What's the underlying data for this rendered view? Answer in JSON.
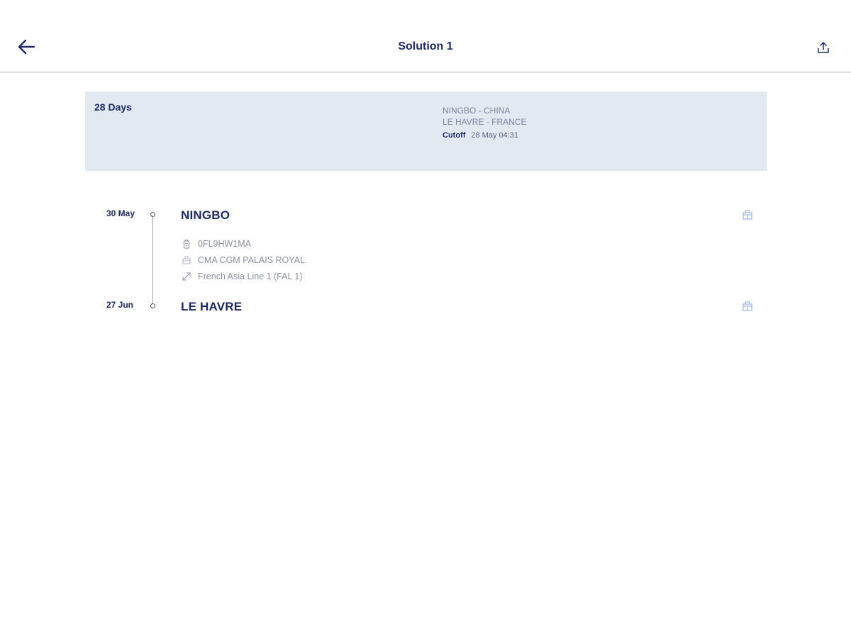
{
  "header": {
    "title": "Solution 1",
    "back_icon": "arrow-left-icon",
    "share_icon": "share-upload-icon"
  },
  "summary": {
    "duration": "28 Days",
    "origin": "NINGBO - CHINA",
    "destination": "LE HAVRE - FRANCE",
    "cutoff_label": "Cutoff",
    "cutoff_value": "28 May 04:31"
  },
  "itinerary": {
    "departure": {
      "date": "30 May",
      "port": "NINGBO",
      "icon": "port-crane-icon"
    },
    "details": [
      {
        "icon": "voyage-ref-icon",
        "text": "0FL9HW1MA"
      },
      {
        "icon": "vessel-icon",
        "text": "CMA CGM PALAIS ROYAL"
      },
      {
        "icon": "route-line-icon",
        "text": "French Asia Line 1 (FAL 1)"
      }
    ],
    "arrival": {
      "date": "27 Jun",
      "port": "LE HAVRE",
      "icon": "port-crane-icon"
    }
  },
  "colors": {
    "primary": "#1d2b63",
    "card_bg": "#e3e9f1",
    "muted_text": "#8a90a2",
    "icon_light": "#9fb6e0"
  }
}
